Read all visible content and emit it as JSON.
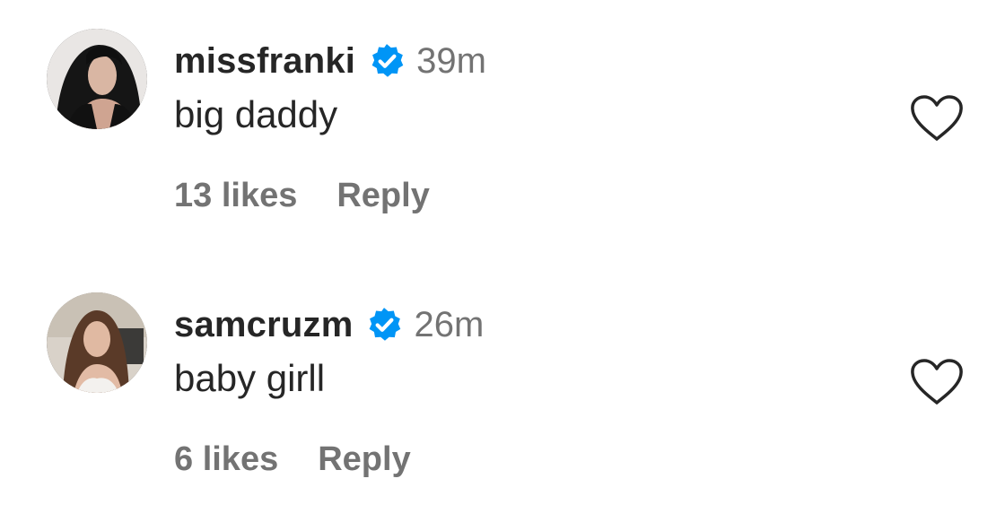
{
  "comments": [
    {
      "username": "missfranki",
      "verified": true,
      "time": "39m",
      "text": "big daddy",
      "likes": "13 likes",
      "reply_label": "Reply",
      "avatar_icon": "avatar-photo"
    },
    {
      "username": "samcruzm",
      "verified": true,
      "time": "26m",
      "text": "baby girll",
      "likes": "6 likes",
      "reply_label": "Reply",
      "avatar_icon": "avatar-photo"
    }
  ],
  "colors": {
    "username": "#262626",
    "muted": "#737373",
    "verified_badge": "#0095f6",
    "heart_outline": "#262626"
  },
  "icons": {
    "verified": "verified-badge-icon",
    "like": "heart-outline-icon"
  }
}
